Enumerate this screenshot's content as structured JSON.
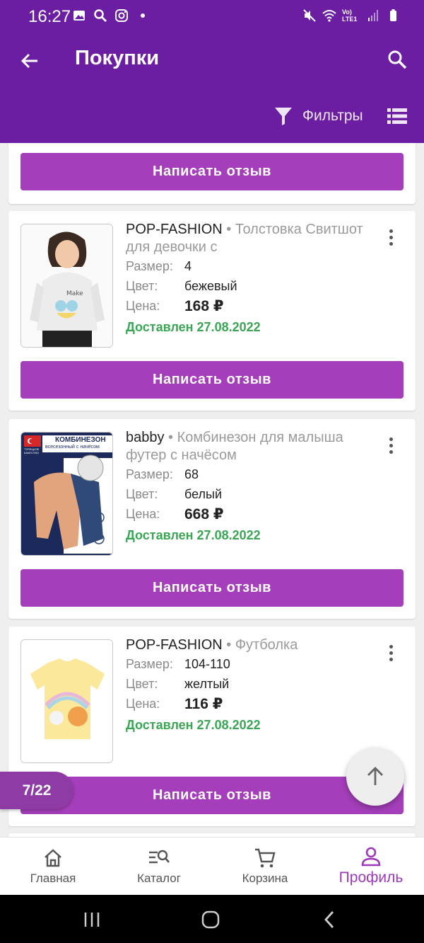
{
  "status_bar": {
    "time": "16:27",
    "lte": "Vo) LTE1"
  },
  "header": {
    "title": "Покупки",
    "filters_label": "Фильтры"
  },
  "top_card": {
    "review_label": "Написать отзыв"
  },
  "products": [
    {
      "brand": "POP-FASHION",
      "sep": " • ",
      "name": "Толстовка Свитшот для девочки с",
      "size_label": "Размер:",
      "size": "4",
      "color_label": "Цвет:",
      "color": "бежевый",
      "price_label": "Цена:",
      "price": "168 ₽",
      "delivered": "Доставлен 27.08.2022",
      "review_label": "Написать отзыв",
      "image": "girl-hoodie"
    },
    {
      "brand": "babby",
      "sep": " • ",
      "name": "Комбинезон для малыша футер с начёсом",
      "size_label": "Размер:",
      "size": "68",
      "color_label": "Цвет:",
      "color": "белый",
      "price_label": "Цена:",
      "price": "668 ₽",
      "delivered": "Доставлен 27.08.2022",
      "review_label": "Написать отзыв",
      "image": "baby-jumpsuit",
      "image_text": {
        "title": "КОМБИНЕЗОН",
        "subtitle": "всесезонный с начёсом",
        "badge": "ТУРЕЦКОЕ КАЧЕСТВО"
      }
    },
    {
      "brand": "POP-FASHION",
      "sep": " • ",
      "name": "Футболка",
      "size_label": "Размер:",
      "size": "104-110",
      "color_label": "Цвет:",
      "color": "желтый",
      "price_label": "Цена:",
      "price": "116 ₽",
      "delivered": "Доставлен 27.08.2022",
      "review_label": "Написать отзыв",
      "image": "yellow-tshirt"
    }
  ],
  "pager": {
    "counter": "7/22"
  },
  "bottom_nav": [
    {
      "label": "Главная",
      "icon": "home-icon",
      "active": false
    },
    {
      "label": "Каталог",
      "icon": "catalog-search-icon",
      "active": false
    },
    {
      "label": "Корзина",
      "icon": "cart-icon",
      "active": false
    },
    {
      "label": "Профиль",
      "icon": "profile-icon",
      "active": true
    }
  ],
  "colors": {
    "primary": "#6c1ea3",
    "button": "#a43eba",
    "delivered": "#3aa655",
    "nav_active": "#9b39b8"
  }
}
